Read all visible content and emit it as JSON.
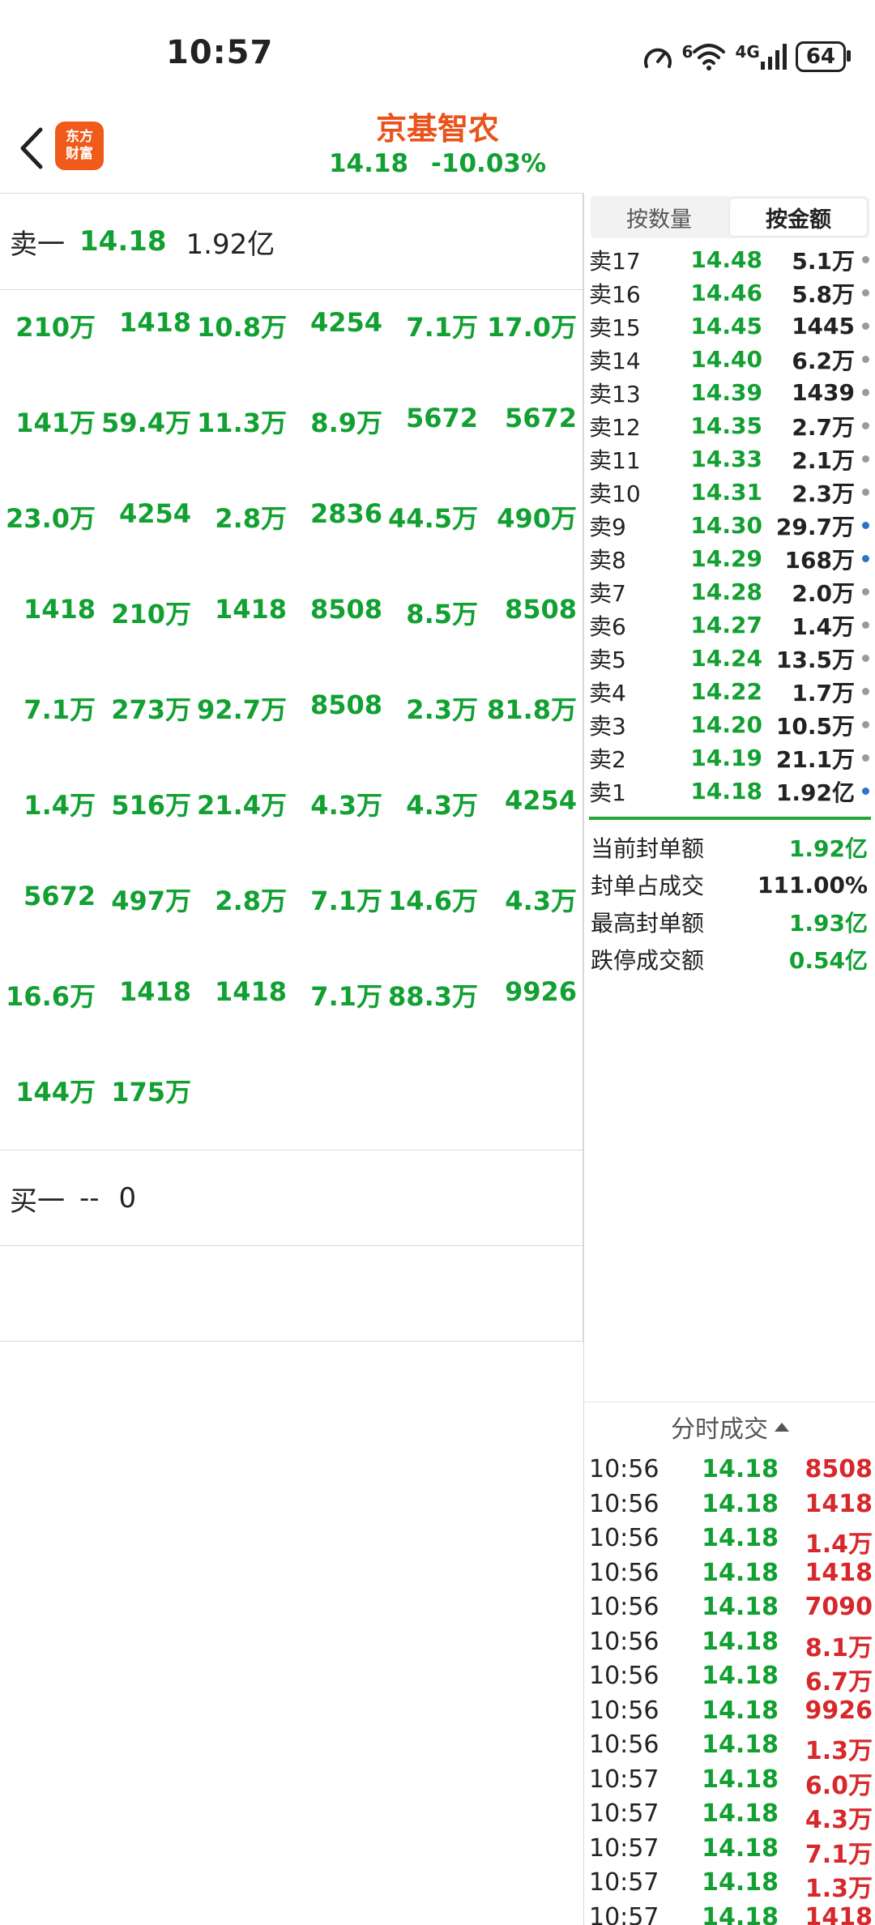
{
  "status_bar": {
    "time": "10:57",
    "network_sup": "6",
    "network_type": "4G",
    "battery": "64"
  },
  "header": {
    "logo_line1": "东方",
    "logo_line2": "财富",
    "stock_name": "京基智农",
    "price": "14.18",
    "change_pct": "-10.03%"
  },
  "left": {
    "sell1_label": "卖一",
    "sell1_price": "14.18",
    "sell1_amount": "1.92亿",
    "orders": [
      [
        "210万",
        "1418",
        "10.8万",
        "4254",
        "7.1万",
        "17.0万"
      ],
      [
        "141万",
        "59.4万",
        "11.3万",
        "8.9万",
        "5672",
        "5672"
      ],
      [
        "23.0万",
        "4254",
        "2.8万",
        "2836",
        "44.5万",
        "490万"
      ],
      [
        "1418",
        "210万",
        "1418",
        "8508",
        "8.5万",
        "8508"
      ],
      [
        "7.1万",
        "273万",
        "92.7万",
        "8508",
        "2.3万",
        "81.8万"
      ],
      [
        "1.4万",
        "516万",
        "21.4万",
        "4.3万",
        "4.3万",
        "4254"
      ],
      [
        "5672",
        "497万",
        "2.8万",
        "7.1万",
        "14.6万",
        "4.3万"
      ],
      [
        "16.6万",
        "1418",
        "1418",
        "7.1万",
        "88.3万",
        "9926"
      ],
      [
        "144万",
        "175万"
      ]
    ],
    "buy1_label": "买一",
    "buy1_price": "--",
    "buy1_amount": "0"
  },
  "right": {
    "tab_quantity": "按数量",
    "tab_amount": "按金额",
    "asks": [
      {
        "label": "卖17",
        "price": "14.48",
        "vol": "5.1万",
        "dot": "grey"
      },
      {
        "label": "卖16",
        "price": "14.46",
        "vol": "5.8万",
        "dot": "grey"
      },
      {
        "label": "卖15",
        "price": "14.45",
        "vol": "1445",
        "dot": "grey"
      },
      {
        "label": "卖14",
        "price": "14.40",
        "vol": "6.2万",
        "dot": "grey"
      },
      {
        "label": "卖13",
        "price": "14.39",
        "vol": "1439",
        "dot": "grey"
      },
      {
        "label": "卖12",
        "price": "14.35",
        "vol": "2.7万",
        "dot": "grey"
      },
      {
        "label": "卖11",
        "price": "14.33",
        "vol": "2.1万",
        "dot": "grey"
      },
      {
        "label": "卖10",
        "price": "14.31",
        "vol": "2.3万",
        "dot": "grey"
      },
      {
        "label": "卖9",
        "price": "14.30",
        "vol": "29.7万",
        "dot": "blue"
      },
      {
        "label": "卖8",
        "price": "14.29",
        "vol": "168万",
        "dot": "blue"
      },
      {
        "label": "卖7",
        "price": "14.28",
        "vol": "2.0万",
        "dot": "grey"
      },
      {
        "label": "卖6",
        "price": "14.27",
        "vol": "1.4万",
        "dot": "grey"
      },
      {
        "label": "卖5",
        "price": "14.24",
        "vol": "13.5万",
        "dot": "grey"
      },
      {
        "label": "卖4",
        "price": "14.22",
        "vol": "1.7万",
        "dot": "grey"
      },
      {
        "label": "卖3",
        "price": "14.20",
        "vol": "10.5万",
        "dot": "grey"
      },
      {
        "label": "卖2",
        "price": "14.19",
        "vol": "21.1万",
        "dot": "grey"
      },
      {
        "label": "卖1",
        "price": "14.18",
        "vol": "1.92亿",
        "dot": "blue"
      }
    ],
    "stats": [
      {
        "label": "当前封单额",
        "value": "1.92亿",
        "color": "green"
      },
      {
        "label": "封单占成交",
        "value": "111.00%",
        "color": "dark"
      },
      {
        "label": "最高封单额",
        "value": "1.93亿",
        "color": "green"
      },
      {
        "label": "跌停成交额",
        "value": "0.54亿",
        "color": "green"
      }
    ],
    "ticks_title": "分时成交",
    "ticks": [
      {
        "time": "10:56",
        "price": "14.18",
        "vol": "8508"
      },
      {
        "time": "10:56",
        "price": "14.18",
        "vol": "1418"
      },
      {
        "time": "10:56",
        "price": "14.18",
        "vol": "1.4万"
      },
      {
        "time": "10:56",
        "price": "14.18",
        "vol": "1418"
      },
      {
        "time": "10:56",
        "price": "14.18",
        "vol": "7090"
      },
      {
        "time": "10:56",
        "price": "14.18",
        "vol": "8.1万"
      },
      {
        "time": "10:56",
        "price": "14.18",
        "vol": "6.7万"
      },
      {
        "time": "10:56",
        "price": "14.18",
        "vol": "9926"
      },
      {
        "time": "10:56",
        "price": "14.18",
        "vol": "1.3万"
      },
      {
        "time": "10:57",
        "price": "14.18",
        "vol": "6.0万"
      },
      {
        "time": "10:57",
        "price": "14.18",
        "vol": "4.3万"
      },
      {
        "time": "10:57",
        "price": "14.18",
        "vol": "7.1万"
      },
      {
        "time": "10:57",
        "price": "14.18",
        "vol": "1.3万"
      },
      {
        "time": "10:57",
        "price": "14.18",
        "vol": "1418"
      }
    ]
  },
  "colors": {
    "down_green": "#11a031",
    "up_red": "#d7282c",
    "brand_orange": "#e8541c",
    "logo_bg": "#f05a1a"
  }
}
